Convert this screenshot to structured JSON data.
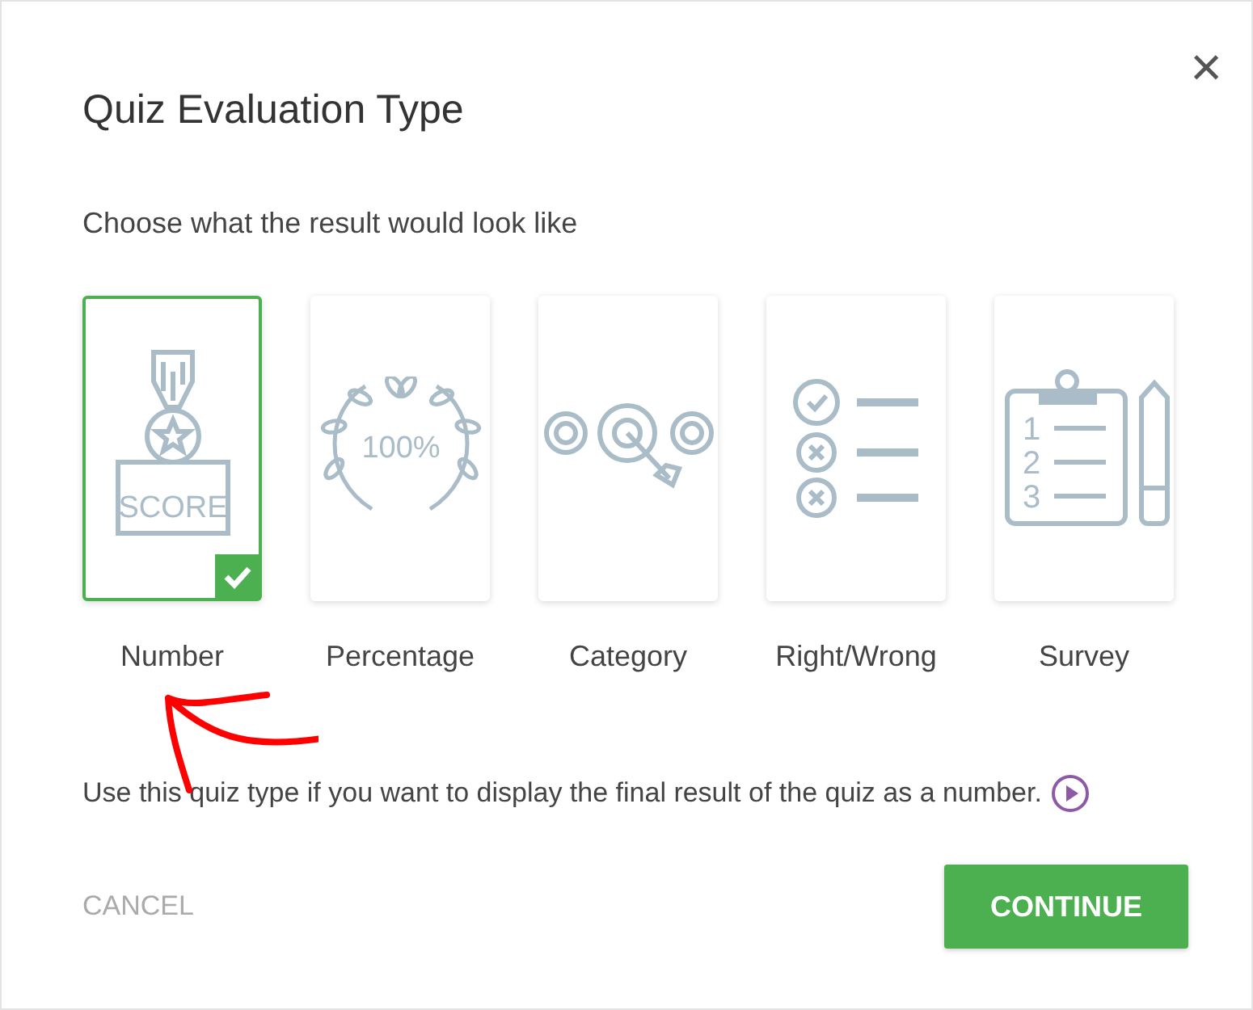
{
  "dialog": {
    "title": "Quiz Evaluation Type",
    "subtitle": "Choose what the result would look like",
    "close": "×"
  },
  "options": [
    {
      "kind": "score",
      "label": "Number",
      "selected": true,
      "icon_text": [
        "SCORE"
      ]
    },
    {
      "kind": "percentage",
      "label": "Percentage",
      "selected": false,
      "icon_text": [
        "100%"
      ]
    },
    {
      "kind": "category",
      "label": "Category",
      "selected": false
    },
    {
      "kind": "rightwrong",
      "label": "Right/Wrong",
      "selected": false
    },
    {
      "kind": "survey",
      "label": "Survey",
      "selected": false,
      "icon_text": [
        "1",
        "2",
        "3"
      ]
    }
  ],
  "description": "Use this quiz type if you want to display the final result of the quiz as a number.",
  "buttons": {
    "cancel": "CANCEL",
    "continue": "CONTINUE"
  }
}
